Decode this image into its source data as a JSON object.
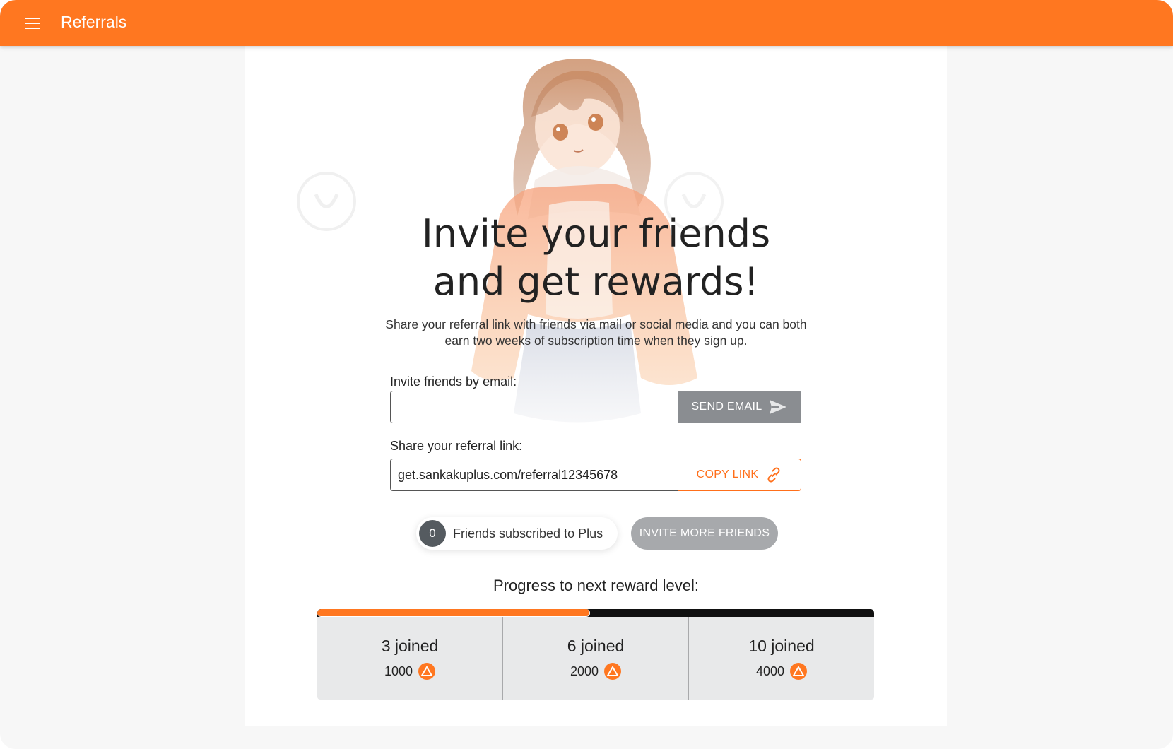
{
  "appbar": {
    "title": "Referrals",
    "menu_icon": "hamburger-menu-icon",
    "color": "#ff7720"
  },
  "hero": {
    "headline_line1": "Invite your friends",
    "headline_line2": "and get rewards!",
    "description": "Share your referral link with friends via mail or social media and you can both earn two weeks of subscription time when they sign up."
  },
  "invite_email": {
    "label": "Invite friends by email:",
    "value": "",
    "placeholder": "",
    "button_label": "SEND EMAIL",
    "button_icon": "send-icon"
  },
  "referral_link": {
    "label": "Share your referral link:",
    "value": "get.sankakuplus.com/referral12345678",
    "button_label": "COPY LINK",
    "button_icon": "link-icon"
  },
  "friends": {
    "count": "0",
    "label": "Friends subscribed to Plus",
    "invite_more_label": "INVITE MORE FRIENDS"
  },
  "progress": {
    "title": "Progress to next reward level:",
    "fraction": 0.49,
    "tiers": [
      {
        "title": "3 joined",
        "reward": "1000",
        "icon": "coin-icon"
      },
      {
        "title": "6 joined",
        "reward": "2000",
        "icon": "coin-icon"
      },
      {
        "title": "10 joined",
        "reward": "4000",
        "icon": "coin-icon"
      }
    ]
  },
  "colors": {
    "accent": "#ff7720",
    "send_button": "#8a8d91",
    "invite_more_button": "#a7a9ac",
    "tier_bg": "#e8e9ea"
  }
}
